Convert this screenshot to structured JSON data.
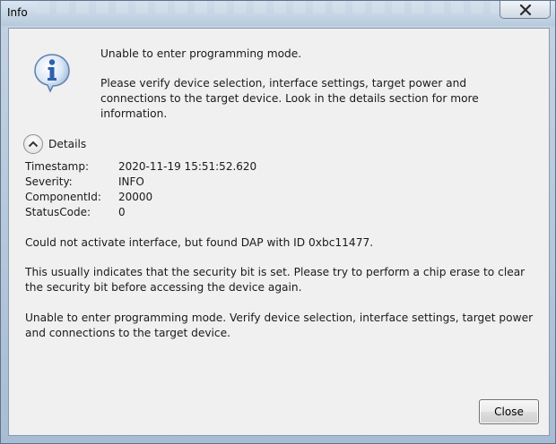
{
  "window": {
    "title": "Info"
  },
  "icons": {
    "close": "close-icon",
    "info": "info-icon",
    "collapse": "chevron-up-icon"
  },
  "message": {
    "headline": "Unable to enter programming mode.",
    "body": "Please verify device selection, interface settings, target power and connections to the target device. Look in the details section for more information."
  },
  "details": {
    "label": "Details",
    "expanded": true,
    "fields": [
      {
        "key": "Timestamp:",
        "value": "2020-11-19 15:51:52.620"
      },
      {
        "key": "Severity:",
        "value": "INFO"
      },
      {
        "key": "ComponentId:",
        "value": "20000"
      },
      {
        "key": "StatusCode:",
        "value": "0"
      }
    ],
    "paragraphs": [
      "Could not activate interface, but found DAP with ID 0xbc11477.",
      "This usually indicates that the security bit is set. Please try to perform a chip erase to clear the security bit before accessing the device again.",
      "Unable to enter programming mode. Verify device selection, interface settings, target power and connections to the target device."
    ]
  },
  "buttons": {
    "close_label": "Close"
  },
  "colors": {
    "info_icon_blue": "#2f5fae",
    "title_bar": "#c3d3e4",
    "dialog_bg": "#f0f0f0"
  }
}
